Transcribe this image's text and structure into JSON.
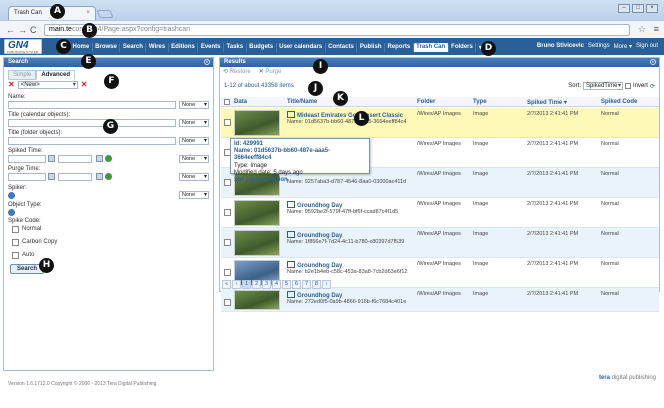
{
  "browser": {
    "tab_title": "Trash Can",
    "tab_close": "×",
    "url_domain": "main.te",
    "url_rest": "com/GN4/Page.aspx?config=trashcan",
    "back": "←",
    "forward": "→",
    "reload": "C",
    "star": "☆",
    "menu": "≡",
    "win_controls": [
      "–",
      "□",
      "×"
    ]
  },
  "app": {
    "logo_text": "GN4",
    "logo_sub": "PUBLISHING SYSTEM",
    "nav": [
      "Home",
      "Browse",
      "Search",
      "Wires",
      "Editions",
      "Events",
      "Tasks",
      "Budgets",
      "User calendars",
      "Contacts",
      "Publish",
      "Reports",
      "Trash Can",
      "Folders",
      "▾"
    ],
    "active_nav": "Trash Can",
    "user": "Bruno Stivicevic",
    "settings": "Settings",
    "more": "More ▾",
    "signout": "Sign out"
  },
  "search": {
    "title": "Search",
    "tab_simple": "Simple",
    "tab_advanced": "Advanced",
    "template": "<New>",
    "fields": {
      "name": "Name:",
      "title_cal": "Title (calendar objects):",
      "title_folder": "Title (folder objects):",
      "spiked_time": "Spiked Time:",
      "purge_time": "Purge Time:",
      "spiker": "Spiker:",
      "object_type": "Object Type:",
      "spike_code": "Spike Code:"
    },
    "none_label": "None",
    "spike_codes": [
      "Normal",
      "Carbon Copy",
      "Auto"
    ],
    "button": "Search"
  },
  "results": {
    "title": "Results",
    "restore": "Restore",
    "purge": "Purge",
    "count": "1-12 of about 43358 items",
    "sort_label": "Sort:",
    "sort_value": "SpikedTime",
    "invert": "Invert",
    "columns": [
      "Data",
      "Title/Name",
      "Folder",
      "Type",
      "Spiked Time ▾",
      "Spiked Code"
    ],
    "rows": [
      {
        "title": "Mideast Emirates Golf Desert Classic",
        "name": "Name: 01d5637b-bb60-487e-aaa5-3664eeff84c4",
        "folder": "/Wires/AP Images",
        "type": "Image",
        "time": "2/7/2013 2:41:41 PM",
        "code": "Normal"
      },
      {
        "title": "",
        "name": "",
        "folder": "/Wires/AP Images",
        "type": "Image",
        "time": "2/7/2013 2:41:41 PM",
        "code": "Normal"
      },
      {
        "title": "",
        "name": "Name: 9257aba3-d787-4546-8aa0-03000ac411d",
        "folder": "/Wires/AP Images",
        "type": "Image",
        "time": "2/7/2013 2:41:41 PM",
        "code": "Normal"
      },
      {
        "title": "Groundhog Day",
        "name": "Name: 9592be2f-579f-47ff-bf6f-ccad87c4f1d5",
        "folder": "/Wires/AP Images",
        "type": "Image",
        "time": "2/7/2013 2:41:41 PM",
        "code": "Normal"
      },
      {
        "title": "Groundhog Day",
        "name": "Name: 1f856e7f-7d24-4c11-b780-c80397d7f539",
        "folder": "/Wires/AP Images",
        "type": "Image",
        "time": "2/7/2013 2:41:41 PM",
        "code": "Normal"
      },
      {
        "title": "Groundhog Day",
        "name": "Name: b2e1b4eb-c58c-453a-83a8-7cb2d63e6f12",
        "folder": "/Wires/AP Images",
        "type": "Image",
        "time": "2/7/2013 2:41:41 PM",
        "code": "Normal"
      },
      {
        "title": "Groundhog Day",
        "name": "Name: 272ed0f5-0a9b-4866-916b-f6c7684c401e",
        "folder": "/Wires/AP Images",
        "type": "Image",
        "time": "2/7/2013 2:41:41 PM",
        "code": "Normal"
      }
    ],
    "tooltip": {
      "id": "Id: 429991",
      "name": "Name: 01d5637b-bb60-487e-aaa5-3664eeff84c4",
      "type": "Type: Image",
      "modified": "Modified date: 5 days ago",
      "xml": "xml representation"
    },
    "pager": [
      "«",
      "‹",
      "1",
      "2",
      "3",
      "4",
      "5",
      "6",
      "7",
      "8",
      "›"
    ]
  },
  "footer": {
    "version": "Version 1.6.1712.0 Copyright © 2006 - 2013 Tera Digital Publishing",
    "brand_a": "tera",
    "brand_b": "digital publishing"
  },
  "markers": [
    "A",
    "B",
    "C",
    "D",
    "E",
    "F",
    "G",
    "H",
    "I",
    "J",
    "K",
    "L"
  ]
}
